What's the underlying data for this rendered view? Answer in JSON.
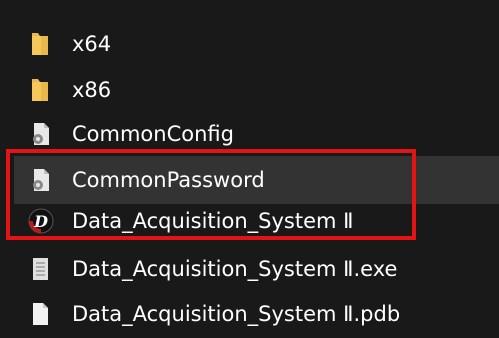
{
  "files": [
    {
      "name": "x64",
      "icon": "folder-icon"
    },
    {
      "name": "x86",
      "icon": "folder-icon"
    },
    {
      "name": "CommonConfig",
      "icon": "config-file-icon"
    },
    {
      "name": "CommonPassword",
      "icon": "config-file-icon"
    },
    {
      "name": "Data_Acquisition_System Ⅱ",
      "icon": "app-d-icon",
      "icon_letter": "D"
    },
    {
      "name": "Data_Acquisition_System Ⅱ.exe",
      "icon": "exe-file-icon"
    },
    {
      "name": "Data_Acquisition_System Ⅱ.pdb",
      "icon": "file-icon"
    }
  ],
  "colors": {
    "background": "#191919",
    "hover": "#333333",
    "highlight_border": "#e41414",
    "folder": "#e8b84a"
  }
}
